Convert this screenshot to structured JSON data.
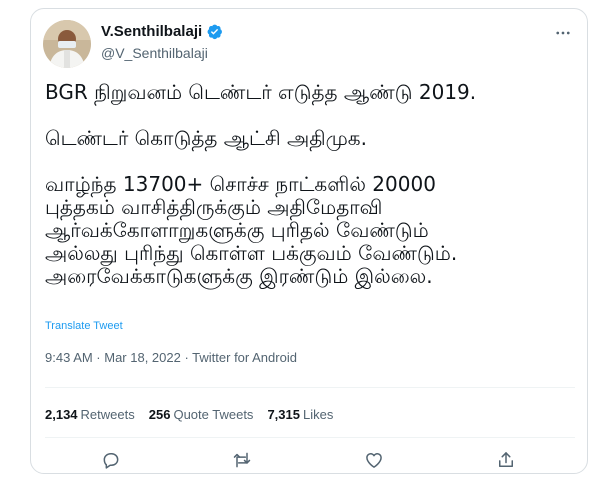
{
  "author": {
    "name": "V.Senthilbalaji",
    "handle": "@V_Senthilbalaji",
    "verified": true,
    "avatar_icon": "avatar-photo"
  },
  "tweet": {
    "lines": [
      "BGR நிறுவனம் டெண்டர் எடுத்த ஆண்டு 2019.",
      "டெண்டர் கொடுத்த ஆட்சி அதிமுக.",
      "வாழ்ந்த 13700+  சொச்ச நாட்களில் 20000",
      "புத்தகம் வாசித்திருக்கும் அதிமேதாவி",
      "ஆர்வக்கோளாறுகளுக்கு புரிதல் வேண்டும்",
      "அல்லது புரிந்து கொள்ள பக்குவம் வேண்டும்.",
      "அரைவேக்காடுகளுக்கு இரண்டும் இல்லை."
    ],
    "translate_label": "Translate Tweet",
    "meta": "9:43 AM · Mar 18, 2022 · Twitter for Android"
  },
  "stats": {
    "retweets_count": "2,134",
    "retweets_label": "Retweets",
    "quotes_count": "256",
    "quotes_label": "Quote Tweets",
    "likes_count": "7,315",
    "likes_label": "Likes"
  },
  "colors": {
    "accent": "#1d9bf0",
    "text": "#0f1419",
    "muted": "#536471",
    "border": "#d9dee2"
  },
  "icons": [
    "verified-badge-icon",
    "more-icon",
    "reply-icon",
    "retweet-icon",
    "like-icon",
    "share-icon"
  ]
}
